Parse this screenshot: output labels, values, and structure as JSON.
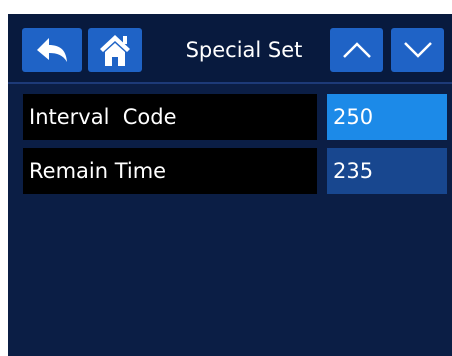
{
  "header": {
    "title": "Special Set",
    "back_icon": "back-arrow-icon",
    "home_icon": "home-icon",
    "up_icon": "chevron-up-icon",
    "down_icon": "chevron-down-icon"
  },
  "rows": [
    {
      "label": "Interval  Code",
      "value": "250",
      "selected": true
    },
    {
      "label": "Remain Time",
      "value": "235",
      "selected": false
    }
  ],
  "colors": {
    "screen_background": "#0b1e45",
    "button": "#1f63c6",
    "value_selected": "#1c8ae8",
    "value_normal": "#18478f",
    "label_background": "#000000"
  }
}
